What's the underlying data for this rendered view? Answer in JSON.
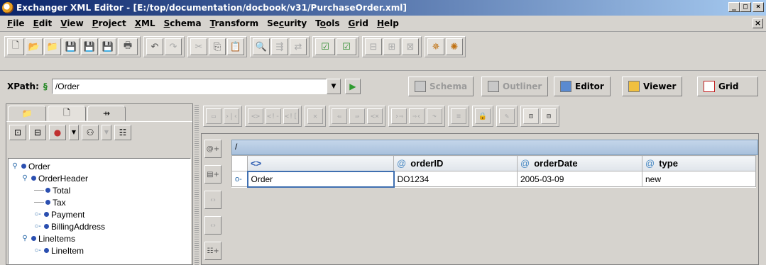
{
  "window": {
    "title": "Exchanger XML Editor - [E:/top/documentation/docbook/v31/PurchaseOrder.xml]",
    "controls": [
      "_",
      "□",
      "×"
    ]
  },
  "menubar": {
    "items": [
      {
        "pre": "",
        "u": "F",
        "post": "ile"
      },
      {
        "pre": "",
        "u": "E",
        "post": "dit"
      },
      {
        "pre": "",
        "u": "V",
        "post": "iew"
      },
      {
        "pre": "",
        "u": "P",
        "post": "roject"
      },
      {
        "pre": "",
        "u": "X",
        "post": "ML"
      },
      {
        "pre": "",
        "u": "S",
        "post": "chema"
      },
      {
        "pre": "",
        "u": "T",
        "post": "ransform"
      },
      {
        "pre": "Se",
        "u": "c",
        "post": "urity"
      },
      {
        "pre": "T",
        "u": "o",
        "post": "ols"
      },
      {
        "pre": "",
        "u": "G",
        "post": "rid"
      },
      {
        "pre": "",
        "u": "H",
        "post": "elp"
      }
    ],
    "close": "×"
  },
  "xpath": {
    "label": "XPath:",
    "value": "/Order"
  },
  "views": {
    "schema": "Schema",
    "outliner": "Outliner",
    "editor": "Editor",
    "viewer": "Viewer",
    "grid": "Grid"
  },
  "tree": {
    "nodes": [
      {
        "label": "Order"
      },
      {
        "label": "OrderHeader"
      },
      {
        "label": "Total"
      },
      {
        "label": "Tax"
      },
      {
        "label": "Payment"
      },
      {
        "label": "BillingAddress"
      },
      {
        "label": "LineItems"
      },
      {
        "label": "LineItem"
      }
    ]
  },
  "grid": {
    "path": "/",
    "columns": {
      "element": "<>",
      "attrs": [
        {
          "at": "@",
          "name": "orderID"
        },
        {
          "at": "@",
          "name": "orderDate"
        },
        {
          "at": "@",
          "name": "type"
        }
      ]
    },
    "rows": [
      {
        "handle": "o-",
        "element": "Order",
        "orderID": "DO1234",
        "orderDate": "2005-03-09",
        "type": "new"
      }
    ]
  },
  "colors": {
    "title_start": "#0a246a",
    "title_end": "#a6caf0",
    "grid_header": "#a8c0dc",
    "selection": "#3f6fb0"
  }
}
